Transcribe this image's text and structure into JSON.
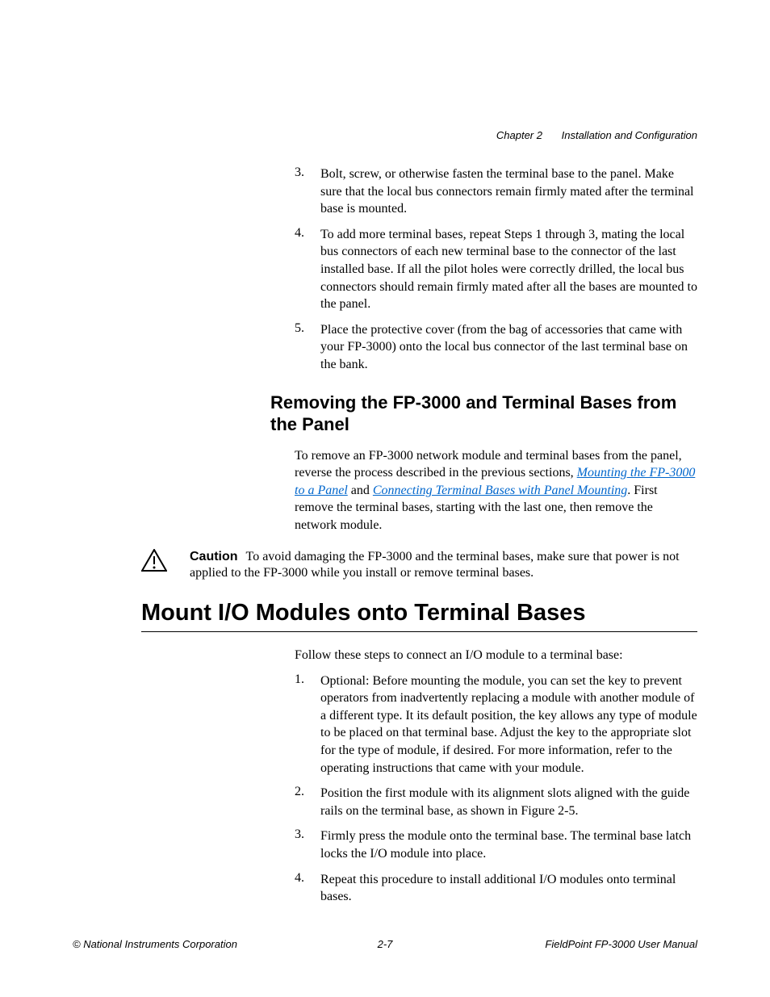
{
  "header": {
    "chapter": "Chapter 2",
    "title": "Installation and Configuration"
  },
  "topList": [
    {
      "n": "3.",
      "t": "Bolt, screw, or otherwise fasten the terminal base to the panel. Make sure that the local bus connectors remain firmly mated after the terminal base is mounted."
    },
    {
      "n": "4.",
      "t": "To add more terminal bases, repeat Steps 1 through 3, mating the local bus connectors of each new terminal base to the connector of the last installed base. If all the pilot holes were correctly drilled, the local bus connectors should remain firmly mated after all the bases are mounted to the panel."
    },
    {
      "n": "5.",
      "t": "Place the protective cover (from the bag of accessories that came with your FP-3000) onto the local bus connector of the last terminal base on the bank."
    }
  ],
  "section2": {
    "heading": "Removing the FP-3000 and Terminal Bases from the Panel",
    "para_pre": "To remove an FP-3000 network module and terminal bases from the panel, reverse the process described in the previous sections, ",
    "link1": "Mounting the FP-3000 to a Panel",
    "mid": " and ",
    "link2": "Connecting Terminal Bases with Panel Mounting",
    "post": ". First remove the terminal bases, starting with the last one, then remove the network module."
  },
  "caution": {
    "label": "Caution",
    "text": "To avoid damaging the FP-3000 and the terminal bases, make sure that power is not applied to the FP-3000 while you install or remove terminal bases."
  },
  "section3": {
    "heading": "Mount I/O Modules onto Terminal Bases",
    "intro": "Follow these steps to connect an I/O module to a terminal base:",
    "steps": [
      {
        "n": "1.",
        "t": "Optional: Before mounting the module, you can set the key to prevent operators from inadvertently replacing a module with another module of a different type. It its default position, the key allows any type of module to be placed on that terminal base. Adjust the key to the appropriate slot for the type of module, if desired. For more information, refer to the operating instructions that came with your module."
      },
      {
        "n": "2.",
        "t": "Position the first module with its alignment slots aligned with the guide rails on the terminal base, as shown in Figure 2-5."
      },
      {
        "n": "3.",
        "t": "Firmly press the module onto the terminal base. The terminal base latch locks the I/O module into place."
      },
      {
        "n": "4.",
        "t": "Repeat this procedure to install additional I/O modules onto terminal bases."
      }
    ]
  },
  "footer": {
    "left": "© National Instruments Corporation",
    "center": "2-7",
    "right": "FieldPoint FP-3000 User Manual"
  }
}
